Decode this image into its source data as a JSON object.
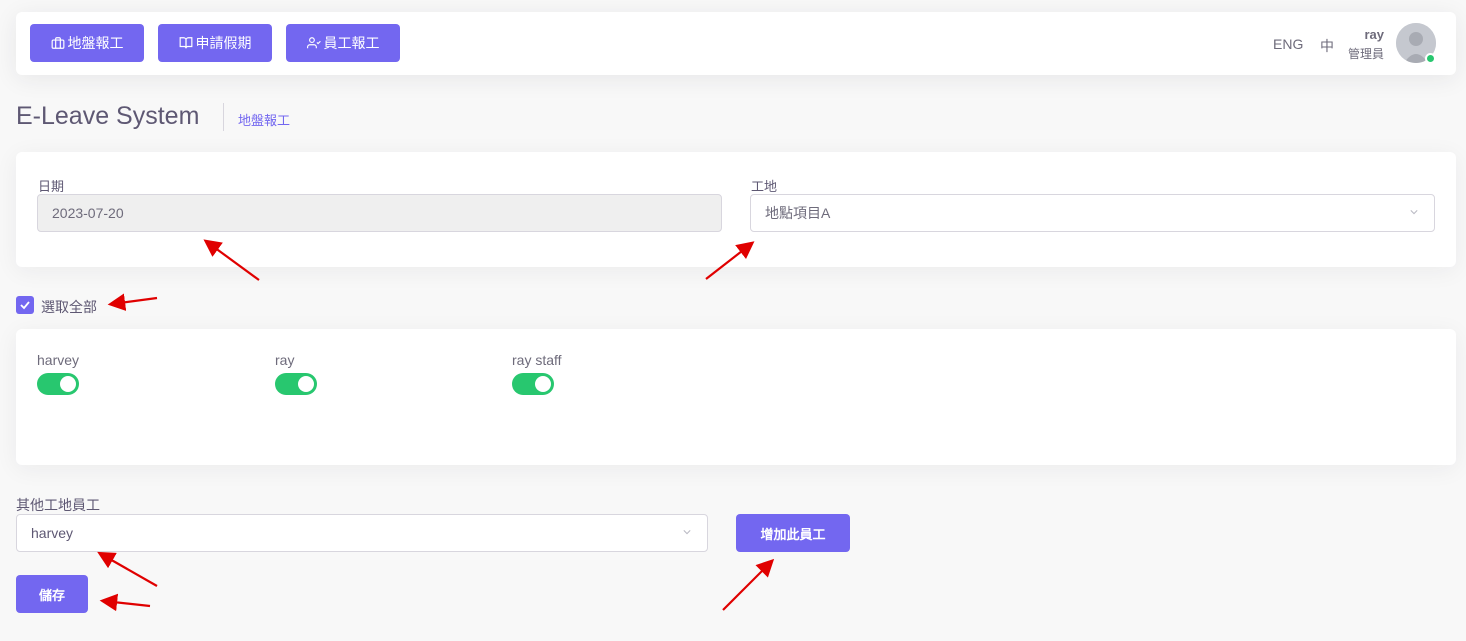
{
  "nav": {
    "buttons": [
      {
        "label": "地盤報工",
        "icon": "briefcase-icon"
      },
      {
        "label": "申請假期",
        "icon": "book-icon"
      },
      {
        "label": "員工報工",
        "icon": "user-check-icon"
      }
    ],
    "lang_en": "ENG",
    "lang_zh": "中",
    "user_name": "ray",
    "user_role": "管理員"
  },
  "page": {
    "title": "E-Leave System",
    "breadcrumb": "地盤報工"
  },
  "form": {
    "date_label": "日期",
    "date_value": "2023-07-20",
    "site_label": "工地",
    "site_value": "地點項目A"
  },
  "select_all": {
    "label": "選取全部",
    "checked": true
  },
  "staff": [
    {
      "name": "harvey",
      "on": true
    },
    {
      "name": "ray",
      "on": true
    },
    {
      "name": "ray staff",
      "on": true
    }
  ],
  "other_staff": {
    "label": "其他工地員工",
    "value": "harvey",
    "add_label": "增加此員工"
  },
  "save_label": "儲存",
  "colors": {
    "primary": "#7367f0",
    "toggle_on": "#28c76f",
    "annotation": "#e00000"
  }
}
